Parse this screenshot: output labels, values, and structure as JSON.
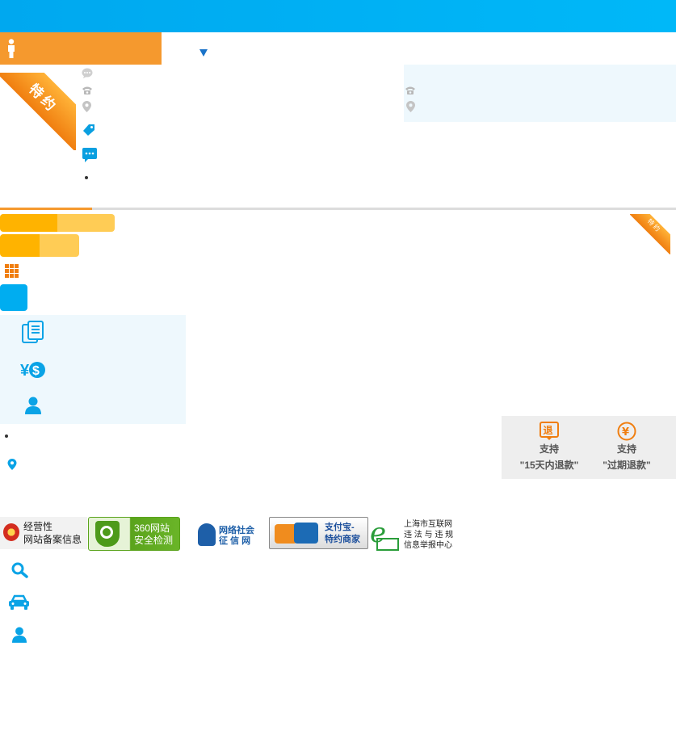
{
  "header": {
    "title": ""
  },
  "ribbons": {
    "main_label": "特约",
    "small_label": "特约"
  },
  "refund": {
    "item1": {
      "line1": "支持",
      "line2": "\"15天内退款\""
    },
    "item2": {
      "line1": "支持",
      "line2": "\"过期退款\""
    }
  },
  "badges": {
    "gov": {
      "line1": "经营性",
      "line2": "网站备案信息"
    },
    "site360": {
      "line1": "360网站",
      "line2": "安全检测"
    },
    "netsoc": {
      "line1": "网络社会",
      "line2": "征 信 网"
    },
    "alipay": {
      "line1": "支付宝-",
      "line2": "特约商家"
    },
    "shanghai": {
      "line1": "上海市互联网",
      "line2": "违 法 与 违 规",
      "line3": "信息举报中心"
    }
  },
  "colors": {
    "topbar": "#00b0f4",
    "accent_orange": "#f5992e",
    "accent_blue": "#00adf0",
    "panel_bg": "#eef8fd"
  },
  "icons": [
    "person-icon",
    "dropdown-arrow-icon",
    "chat-bubble-icon",
    "phone-icon",
    "location-pin-icon",
    "tag-icon",
    "message-icon",
    "grid-icon",
    "document-icon",
    "currency-icon",
    "user-icon",
    "search-icon",
    "car-icon"
  ]
}
